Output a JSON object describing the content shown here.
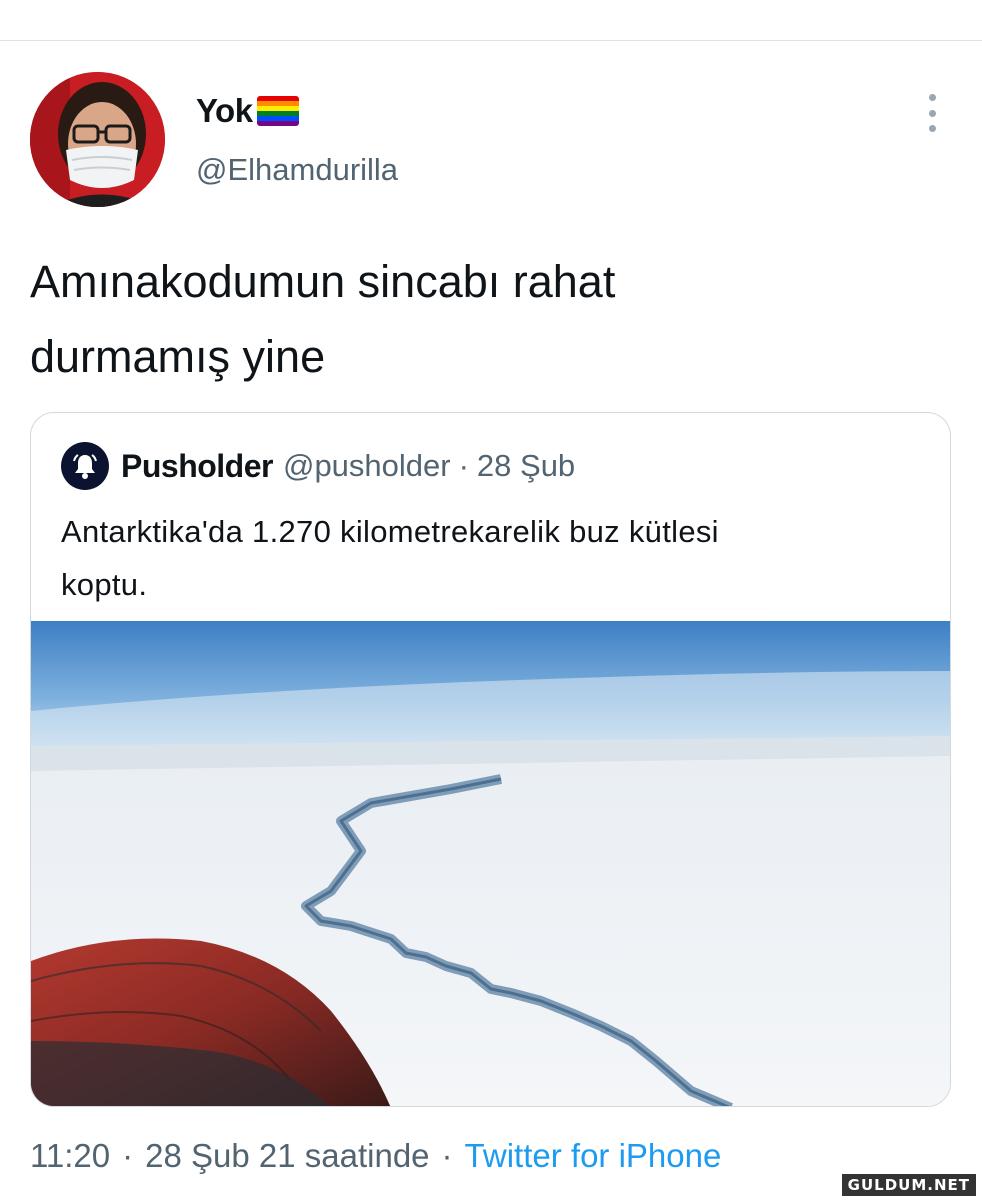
{
  "author": {
    "display_name": "Yok",
    "handle": "@Elhamdurilla",
    "avatar_icon": "profile-photo-masked-man",
    "name_emoji_icon": "rainbow-flag-icon"
  },
  "tweet": {
    "text_line1": "Amınakodumun sincabı rahat",
    "text_line2": "durmamış yine"
  },
  "quoted_tweet": {
    "display_name": "Pusholder",
    "handle": "@pusholder",
    "separator": "·",
    "date": "28 Şub",
    "avatar_icon": "bell-icon",
    "text_line1": "Antarktika'da 1.270 kilometrekarelik buz kütlesi",
    "text_line2": "koptu.",
    "media_icon": "antarctic-ice-crack-photo"
  },
  "meta": {
    "time": "11:20",
    "separator": "·",
    "date": "28 Şub 21 saatinde",
    "source": "Twitter for iPhone"
  },
  "watermark": "GULDUM.NET",
  "colors": {
    "text_primary": "#0f1419",
    "text_secondary": "#536471",
    "link": "#1d9bf0",
    "border": "#cfd9de"
  }
}
